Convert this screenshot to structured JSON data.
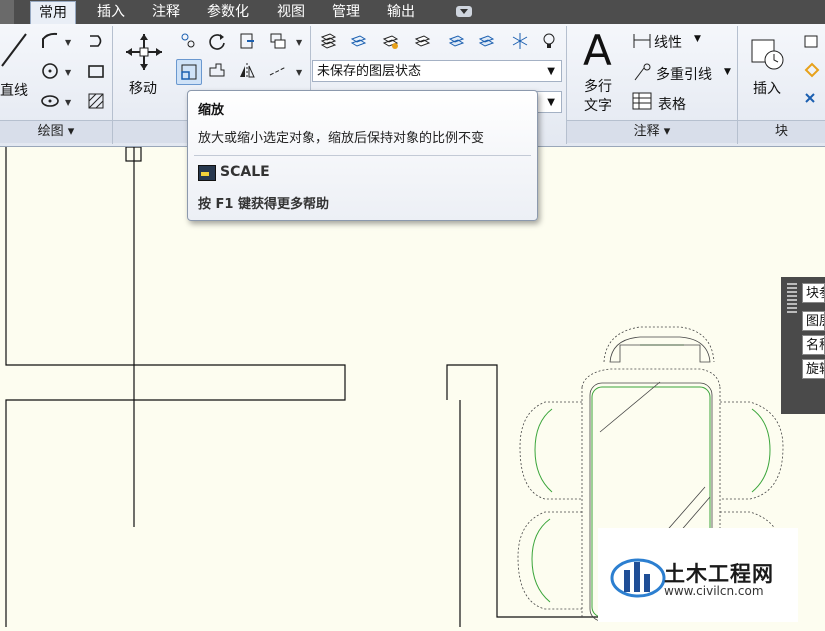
{
  "menu": {
    "tabs": [
      {
        "label": "常用",
        "active": true
      },
      {
        "label": "插入",
        "active": false
      },
      {
        "label": "注释",
        "active": false
      },
      {
        "label": "参数化",
        "active": false
      },
      {
        "label": "视图",
        "active": false
      },
      {
        "label": "管理",
        "active": false
      },
      {
        "label": "输出",
        "active": false
      }
    ]
  },
  "ribbon": {
    "draw": {
      "line_label": "直线",
      "panel_label": "绘图 ▾"
    },
    "modify": {
      "move_label": "移动"
    },
    "layers": {
      "state_value": "未保存的图层状态"
    },
    "annotation": {
      "linear_label": "线性",
      "multileader_label": "多重引线",
      "table_label": "表格",
      "mtext_label_1": "多行",
      "mtext_label_2": "文字",
      "panel_label": "注释 ▾"
    },
    "block": {
      "insert_label": "插入",
      "panel_label": "块"
    }
  },
  "tooltip": {
    "title": "缩放",
    "description": "放大或缩小选定对象，缩放后保持对象的比例不变",
    "command": "SCALE",
    "help": "按 F1 键获得更多帮助"
  },
  "palette": {
    "rows": [
      "块参",
      "图层",
      "名称",
      "旋转"
    ]
  },
  "watermark": {
    "title": "土木工程网",
    "url": "www.civilcn.com"
  },
  "colors": {
    "menubar": "#4d4d4d",
    "canvas": "#fdfdf0",
    "accent_green": "#3aa53a"
  }
}
